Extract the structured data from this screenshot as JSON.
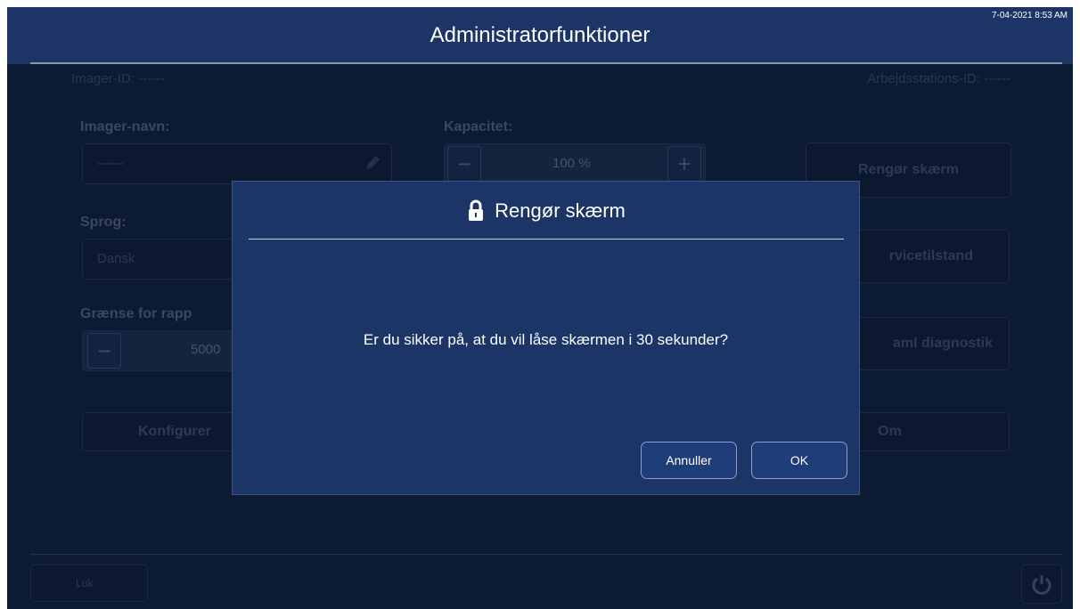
{
  "header": {
    "title": "Administratorfunktioner",
    "datetime": "7-04-2021 8:53 AM"
  },
  "background": {
    "imager_id": "Imager-ID: ------",
    "workstation_id": "Arbejdsstations-ID: ------",
    "imager_name_label": "Imager-navn:",
    "imager_name_value": "------",
    "capacity_label": "Kapacitet:",
    "capacity_value": "100 %",
    "language_label": "Sprog:",
    "language_value": "Dansk",
    "report_limit_label": "Grænse for rapp",
    "report_limit_value": "5000",
    "configure_button": "Konfigurer",
    "clean_screen_button": "Rengør skærm",
    "service_mode_button": "rvicetilstand",
    "diagnostics_button": "aml diagnostik",
    "about_button": "Om",
    "close_button": "Luk",
    "minus": "−",
    "plus": "+"
  },
  "dialog": {
    "title": "Rengør skærm",
    "icon": "lock-icon",
    "message": "Er du sikker på, at du vil låse skærmen i 30 sekunder?",
    "cancel_label": "Annuller",
    "ok_label": "OK"
  },
  "colors": {
    "header_bg": "#1c3566",
    "dialog_bg": "#1a3566",
    "screen_bg": "#0d1a33"
  }
}
